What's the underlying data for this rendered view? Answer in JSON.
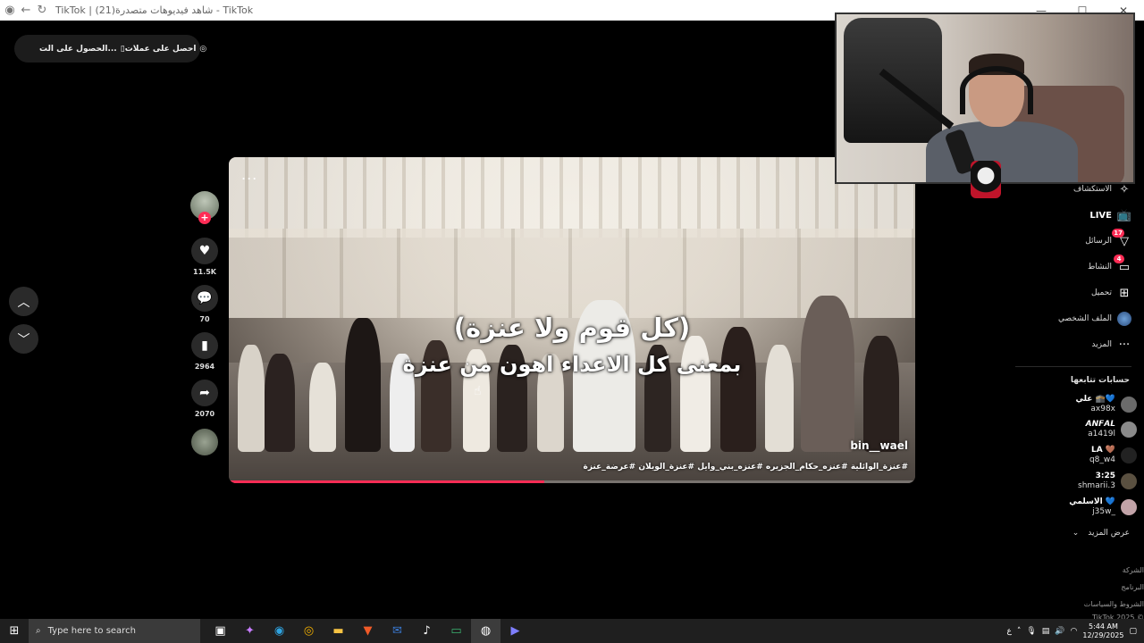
{
  "browser": {
    "title": "TikTok | شاهد فيديوهات متصدرة(21) - TikTok"
  },
  "top_pill": {
    "coins_label": "احصل على عملات",
    "app_label": "الحصول على الت..."
  },
  "video": {
    "subtitle_line1": "(كل قوم ولا عنزة)",
    "subtitle_line2": "بمعنى كل الاعداء اهون من عنزة",
    "author": "bin__wael",
    "hashtags": "#عنزة_الوائلية #عنزه_حكام_الجزيره #عنزه_بني_وايل #عنزة_الويلان #عرضة_عنزة",
    "more_label": "...",
    "progress": 0.46
  },
  "actions": {
    "likes": "11.5K",
    "comments": "70",
    "saves": "2964",
    "shares": "2070"
  },
  "sidebar": {
    "items": [
      {
        "label": "الاستكشاف",
        "icon": "explore-icon"
      },
      {
        "label": "LIVE",
        "icon": "live-icon"
      },
      {
        "label": "الرسائل",
        "icon": "messages-icon",
        "badge": "17"
      },
      {
        "label": "النشاط",
        "icon": "activity-icon",
        "badge": "4"
      },
      {
        "label": "تحميل",
        "icon": "upload-icon"
      },
      {
        "label": "الملف الشخصي",
        "icon": "profile-icon"
      },
      {
        "label": "المزيد",
        "icon": "more-icon"
      }
    ],
    "following_title": "حسابات تتابعها",
    "following": [
      {
        "name": "علي 🕋💙",
        "handle": "ax98x",
        "color": "#6b6b6b"
      },
      {
        "name": "𝘼𝙉𝙁𝘼𝙇",
        "handle": "a1419l",
        "color": "#8a8a8a"
      },
      {
        "name": "LA 🤎",
        "handle": "q8_w4",
        "color": "#222"
      },
      {
        "name": "3:25",
        "handle": "shmarii.3",
        "color": "#5a5040"
      },
      {
        "name": "الاسلمي 💙",
        "handle": "j35w_",
        "color": "#c2a3a8"
      }
    ],
    "see_more": "عرض المزيد",
    "footer": [
      "الشركة",
      "البرنامج",
      "الشروط والسياسات",
      "TikTok 2025 ©"
    ]
  },
  "taskbar": {
    "search_placeholder": "Type here to search",
    "time": "5:44 AM",
    "date": "12/29/2025",
    "lang": "ع"
  }
}
